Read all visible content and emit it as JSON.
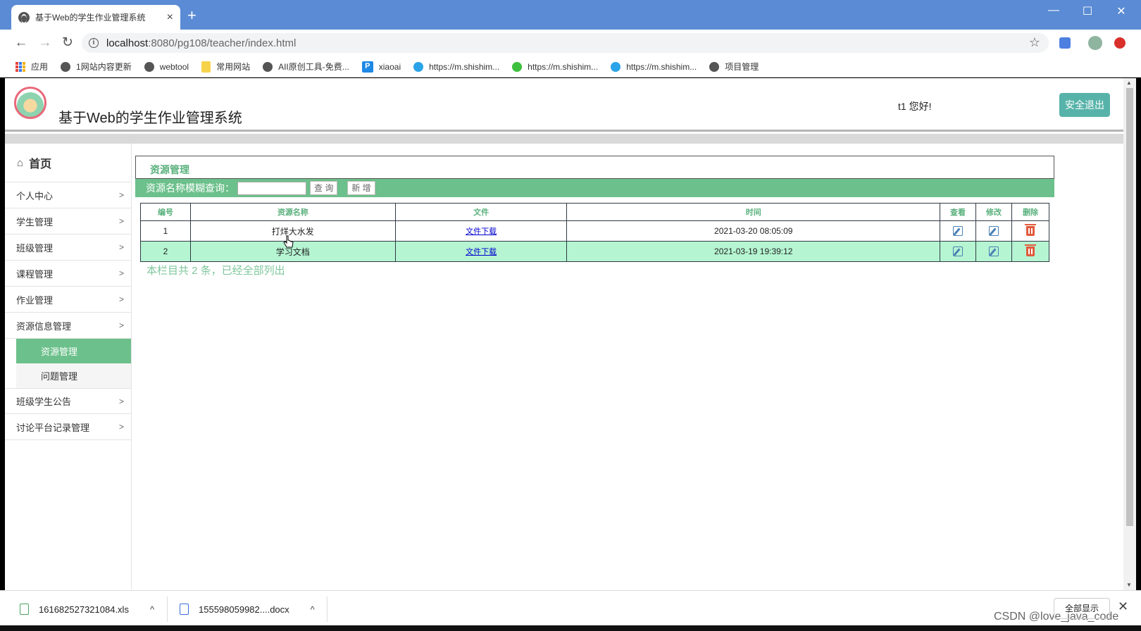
{
  "browser": {
    "tab_title": "基于Web的学生作业管理系统",
    "tab_close": "×",
    "new_tab": "+",
    "window_controls": {
      "minimize": "—",
      "maximize": "☐",
      "close": "✕"
    },
    "url_host": "localhost",
    "url_path": ":8080/pg108/teacher/index.html",
    "bookmarks": [
      {
        "label": "应用",
        "icon": "apps-icon"
      },
      {
        "label": "1网站内容更新",
        "icon": "globe-icon"
      },
      {
        "label": "webtool",
        "icon": "globe-icon"
      },
      {
        "label": "常用网站",
        "icon": "folder-icon"
      },
      {
        "label": "AII原创工具-免费...",
        "icon": "globe-icon"
      },
      {
        "label": "xiaoai",
        "icon": "p-icon"
      },
      {
        "label": "https://m.shishim...",
        "icon": "c-icon"
      },
      {
        "label": "https://m.shishim...",
        "icon": "wechat-icon"
      },
      {
        "label": "https://m.shishim...",
        "icon": "c-icon"
      },
      {
        "label": "项目管理",
        "icon": "globe-icon"
      }
    ]
  },
  "header": {
    "system_title": "基于Web的学生作业管理系统",
    "greeting": "t1 您好!",
    "logout_label": "安全退出"
  },
  "sidebar": {
    "home_label": "首页",
    "items": [
      {
        "label": "个人中心",
        "chevron": ">"
      },
      {
        "label": "学生管理",
        "chevron": ">"
      },
      {
        "label": "班级管理",
        "chevron": ">"
      },
      {
        "label": "课程管理",
        "chevron": ">"
      },
      {
        "label": "作业管理",
        "chevron": ">"
      },
      {
        "label": "资源信息管理",
        "chevron": ">"
      }
    ],
    "sub_items": [
      {
        "label": "资源管理",
        "active": true
      },
      {
        "label": "问题管理",
        "active": false
      }
    ],
    "items_after": [
      {
        "label": "班级学生公告",
        "chevron": ">"
      },
      {
        "label": "讨论平台记录管理",
        "chevron": ">"
      }
    ]
  },
  "main": {
    "panel_title": "资源管理",
    "search_label": "资源名称模糊查询：",
    "search_value": "",
    "query_button": "查 询",
    "add_button": "新 增",
    "columns": [
      "编号",
      "资源名称",
      "文件",
      "时间",
      "查看",
      "修改",
      "删除"
    ],
    "rows": [
      {
        "id": "1",
        "name": "打烊大水发",
        "file": "文件下载",
        "time": "2021-03-20 08:05:09"
      },
      {
        "id": "2",
        "name": "学习文档",
        "file": "文件下载",
        "time": "2021-03-19 19:39:12"
      }
    ],
    "footer_note": "本栏目共 2 条，已经全部列出"
  },
  "downloads": {
    "items": [
      {
        "filename": "161682527321084.xls",
        "type": "xls"
      },
      {
        "filename": "155598059982....docx",
        "type": "docx"
      }
    ],
    "chevron": "^",
    "show_all": "全部显示",
    "close": "✕"
  },
  "watermark": "CSDN @love_java_code",
  "colors": {
    "accent_green": "#6cc08b",
    "alt_row": "#b5f5d2",
    "logout_bg": "#57b3a9",
    "tab_strip": "#5a8bd4"
  }
}
